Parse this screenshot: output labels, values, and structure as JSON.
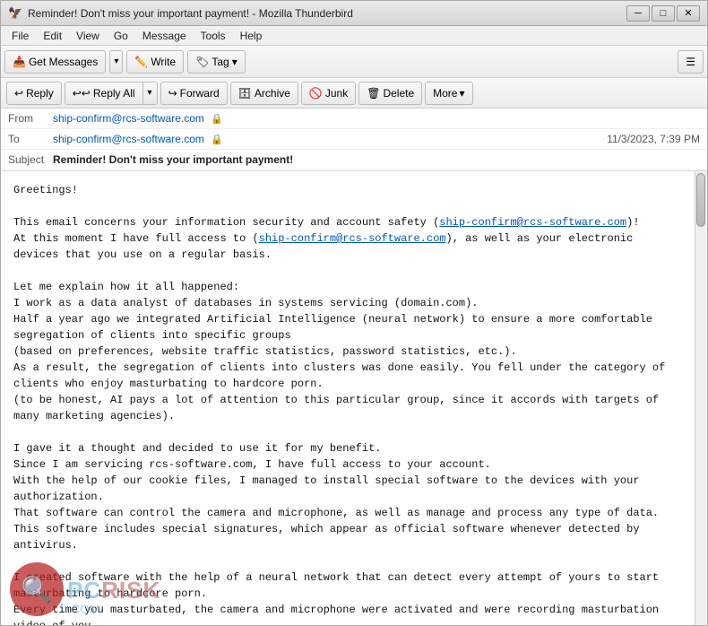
{
  "window": {
    "title": "Reminder! Don't miss your important payment! - Mozilla Thunderbird",
    "icon": "🦅"
  },
  "titlebar": {
    "title": "Reminder! Don't miss your important payment! - Mozilla Thunderbird",
    "minimize_label": "─",
    "maximize_label": "□",
    "close_label": "✕"
  },
  "menubar": {
    "items": [
      {
        "label": "File"
      },
      {
        "label": "Edit"
      },
      {
        "label": "View"
      },
      {
        "label": "Go"
      },
      {
        "label": "Message"
      },
      {
        "label": "Tools"
      },
      {
        "label": "Help"
      }
    ]
  },
  "toolbar": {
    "get_messages_label": "Get Messages",
    "write_label": "Write",
    "tag_label": "Tag",
    "hamburger": "☰"
  },
  "email_toolbar": {
    "reply_label": "Reply",
    "reply_all_label": "Reply All",
    "forward_label": "Forward",
    "archive_label": "Archive",
    "junk_label": "Junk",
    "delete_label": "Delete",
    "more_label": "More",
    "chevron": "▾"
  },
  "email": {
    "from_label": "From",
    "from_address": "ship-confirm@rcs-software.com",
    "to_label": "To",
    "to_address": "ship-confirm@rcs-software.com",
    "date": "11/3/2023, 7:39 PM",
    "subject_label": "Subject",
    "subject": "Reminder! Don't miss your important payment!",
    "body": "Greetings!\n\nThis email concerns your information security and account safety (ship-confirm@rcs-software.com)!\nAt this moment I have full access to (ship-confirm@rcs-software.com), as well as your electronic\ndevices that you use on a regular basis.\n\nLet me explain how it all happened:\nI work as a data analyst of databases in systems servicing (domain.com).\nHalf a year ago we integrated Artificial Intelligence (neural network) to ensure a more comfortable\nsegregation of clients into specific groups\n(based on preferences, website traffic statistics, password statistics, etc.).\nAs a result, the segregation of clients into clusters was done easily. You fell under the category of\nclients who enjoy masturbating to hardcore porn.\n(to be honest, AI pays a lot of attention to this particular group, since it accords with targets of\nmany marketing agencies).\n\nI gave it a thought and decided to use it for my benefit.\nSince I am servicing rcs-software.com, I have full access to your account.\nWith the help of our cookie files, I managed to install special software to the devices with your\nauthorization.\nThat software can control the camera and microphone, as well as manage and process any type of data.\nThis software includes special signatures, which appear as official software whenever detected by\nantivirus.\n\nI created software with the help of a neural network that can detect every attempt of yours to start\nmasturbating to hardcore porn.\nEvery time you masturbated, the camera and microphone were activated and were recording masturbation\nvideo of you\nIt means that the porn video which you masturbate to, was displayed in the corner.) and sending it\nto my server.",
    "link1": "ship-confirm@rcs-software.com",
    "link2": "ship-confirm@rcs-software.com"
  },
  "watermark": {
    "site": "PC RISK",
    "domain": ".COM",
    "magnifier": "🔍"
  }
}
